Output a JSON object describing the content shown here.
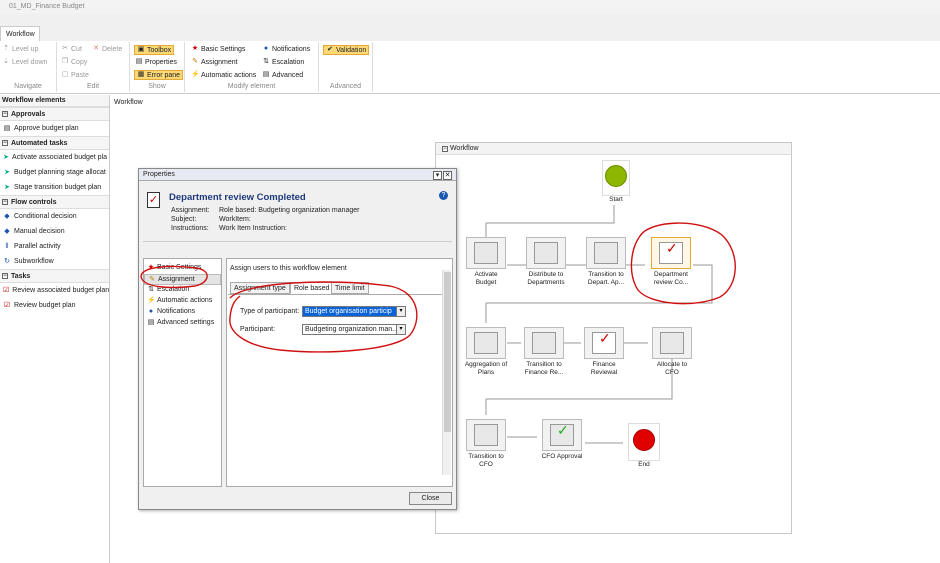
{
  "window": {
    "title": "01_MD_Finance Budget"
  },
  "tabs": [
    {
      "label": "Workflow"
    }
  ],
  "ribbon": {
    "navigate": {
      "label": "Navigate",
      "level_up": "Level up",
      "level_down": "Level down"
    },
    "edit": {
      "label": "Edit",
      "cut": "Cut",
      "delete": "Delete",
      "copy": "Copy",
      "paste": "Paste"
    },
    "show": {
      "label": "Show",
      "toolbox": "Toolbox",
      "properties": "Properties",
      "error_pane": "Error pane"
    },
    "modify": {
      "label": "Modify element",
      "basic_settings": "Basic Settings",
      "notifications": "Notifications",
      "assignment": "Assignment",
      "escalation": "Escalation",
      "automatic_actions": "Automatic actions",
      "advanced": "Advanced"
    },
    "advanced": {
      "label": "Advanced",
      "validation": "Validation"
    }
  },
  "left_panel": {
    "title": "Workflow elements",
    "sections": [
      {
        "name": "Approvals",
        "items": [
          "Approve budget plan"
        ]
      },
      {
        "name": "Automated tasks",
        "items": [
          "Activate associated budget pla",
          "Budget planning stage allocat",
          "Stage transition budget plan"
        ]
      },
      {
        "name": "Flow controls",
        "items": [
          "Conditional decision",
          "Manual decision",
          "Parallel activity",
          "Subworkflow"
        ]
      },
      {
        "name": "Tasks",
        "items": [
          "Review associated budget plan",
          "Review budget plan"
        ]
      }
    ]
  },
  "canvas": {
    "label": "Workflow",
    "panel_title": "Workflow"
  },
  "workflow_nodes": {
    "start": "Start",
    "activate": "Activate Budget",
    "distribute": "Distribute to Departments",
    "transition_depart": "Transition to Depart. Ap...",
    "dept_review": "Department review Co...",
    "aggregation": "Aggregation of Plans",
    "transition_finance": "Transition to Finance Re...",
    "finance_reviewal": "Finance Reviewal",
    "allocate_cfo": "Allocate to CFO",
    "transition_cfo": "Transition to CFO",
    "cfo_approval": "CFO Approval",
    "end": "End"
  },
  "dialog": {
    "title": "Properties",
    "headline": "Department review Completed",
    "assignment_key": "Assignment:",
    "assignment_val": "Role based: Budgeting organization manager",
    "subject_key": "Subject:",
    "subject_val": "WorkItem:",
    "instructions_key": "Instructions:",
    "instructions_val": "Work Item Instruction:",
    "nav": [
      "Basic Settings",
      "Assignment",
      "Escalation",
      "Automatic actions",
      "Notifications",
      "Advanced settings"
    ],
    "selected_nav": "Assignment",
    "panel_title": "Assign users to this workflow element",
    "subtabs": [
      "Assignment type",
      "Role based",
      "Time limit"
    ],
    "active_subtab": "Role based",
    "type_label": "Type of participant:",
    "type_value": "Budget organisation particip",
    "participant_label": "Participant:",
    "participant_value": "Budgeting organization man...",
    "close": "Close"
  },
  "colors": {
    "accent": "#fbd977",
    "selection": "#0a64d8",
    "annotation": "#d01010",
    "start": "#8db600",
    "end": "#e00000"
  }
}
